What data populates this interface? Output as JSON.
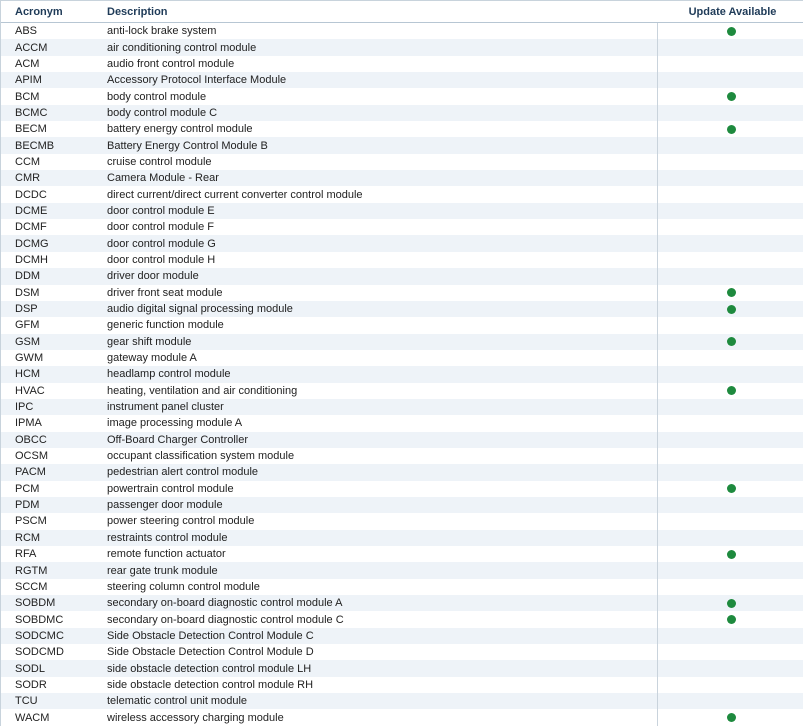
{
  "table": {
    "headers": {
      "acronym": "Acronym",
      "description": "Description",
      "update": "Update Available"
    },
    "rows": [
      {
        "acronym": "ABS",
        "description": "anti-lock brake system",
        "update": true
      },
      {
        "acronym": "ACCM",
        "description": "air conditioning control module",
        "update": false
      },
      {
        "acronym": "ACM",
        "description": "audio front control module",
        "update": false
      },
      {
        "acronym": "APIM",
        "description": "Accessory Protocol Interface Module",
        "update": false
      },
      {
        "acronym": "BCM",
        "description": "body control module",
        "update": true
      },
      {
        "acronym": "BCMC",
        "description": "body control module C",
        "update": false
      },
      {
        "acronym": "BECM",
        "description": "battery energy control module",
        "update": true
      },
      {
        "acronym": "BECMB",
        "description": "Battery Energy Control Module B",
        "update": false
      },
      {
        "acronym": "CCM",
        "description": "cruise control module",
        "update": false
      },
      {
        "acronym": "CMR",
        "description": "Camera Module - Rear",
        "update": false
      },
      {
        "acronym": "DCDC",
        "description": "direct current/direct current converter control module",
        "update": false
      },
      {
        "acronym": "DCME",
        "description": "door control module E",
        "update": false
      },
      {
        "acronym": "DCMF",
        "description": "door control module F",
        "update": false
      },
      {
        "acronym": "DCMG",
        "description": "door control module G",
        "update": false
      },
      {
        "acronym": "DCMH",
        "description": "door control module H",
        "update": false
      },
      {
        "acronym": "DDM",
        "description": "driver door module",
        "update": false
      },
      {
        "acronym": "DSM",
        "description": "driver front seat module",
        "update": true
      },
      {
        "acronym": "DSP",
        "description": "audio digital signal processing module",
        "update": true
      },
      {
        "acronym": "GFM",
        "description": "generic function module",
        "update": false
      },
      {
        "acronym": "GSM",
        "description": "gear shift module",
        "update": true
      },
      {
        "acronym": "GWM",
        "description": "gateway module A",
        "update": false
      },
      {
        "acronym": "HCM",
        "description": "headlamp control module",
        "update": false
      },
      {
        "acronym": "HVAC",
        "description": "heating, ventilation and air conditioning",
        "update": true
      },
      {
        "acronym": "IPC",
        "description": "instrument panel cluster",
        "update": false
      },
      {
        "acronym": "IPMA",
        "description": "image processing module A",
        "update": false
      },
      {
        "acronym": "OBCC",
        "description": "Off-Board Charger Controller",
        "update": false
      },
      {
        "acronym": "OCSM",
        "description": "occupant classification system module",
        "update": false
      },
      {
        "acronym": "PACM",
        "description": "pedestrian alert control module",
        "update": false
      },
      {
        "acronym": "PCM",
        "description": "powertrain control module",
        "update": true
      },
      {
        "acronym": "PDM",
        "description": "passenger door module",
        "update": false
      },
      {
        "acronym": "PSCM",
        "description": "power steering control module",
        "update": false
      },
      {
        "acronym": "RCM",
        "description": "restraints control module",
        "update": false
      },
      {
        "acronym": "RFA",
        "description": "remote function actuator",
        "update": true
      },
      {
        "acronym": "RGTM",
        "description": "rear gate trunk module",
        "update": false
      },
      {
        "acronym": "SCCM",
        "description": "steering column control module",
        "update": false
      },
      {
        "acronym": "SOBDM",
        "description": "secondary on-board diagnostic control module A",
        "update": true
      },
      {
        "acronym": "SOBDMC",
        "description": "secondary on-board diagnostic control module C",
        "update": true
      },
      {
        "acronym": "SODCMC",
        "description": "Side Obstacle Detection Control Module C",
        "update": false
      },
      {
        "acronym": "SODCMD",
        "description": "Side Obstacle Detection Control Module D",
        "update": false
      },
      {
        "acronym": "SODL",
        "description": "side obstacle detection control module LH",
        "update": false
      },
      {
        "acronym": "SODR",
        "description": "side obstacle detection control module RH",
        "update": false
      },
      {
        "acronym": "TCU",
        "description": "telematic control unit module",
        "update": false
      },
      {
        "acronym": "WACM",
        "description": "wireless accessory charging module",
        "update": true
      }
    ]
  },
  "colors": {
    "update_dot": "#1e8a3e",
    "header_text": "#1f3b58",
    "row_stripe": "#eef3f8"
  },
  "icons": {
    "update_indicator": "green-dot-icon"
  }
}
